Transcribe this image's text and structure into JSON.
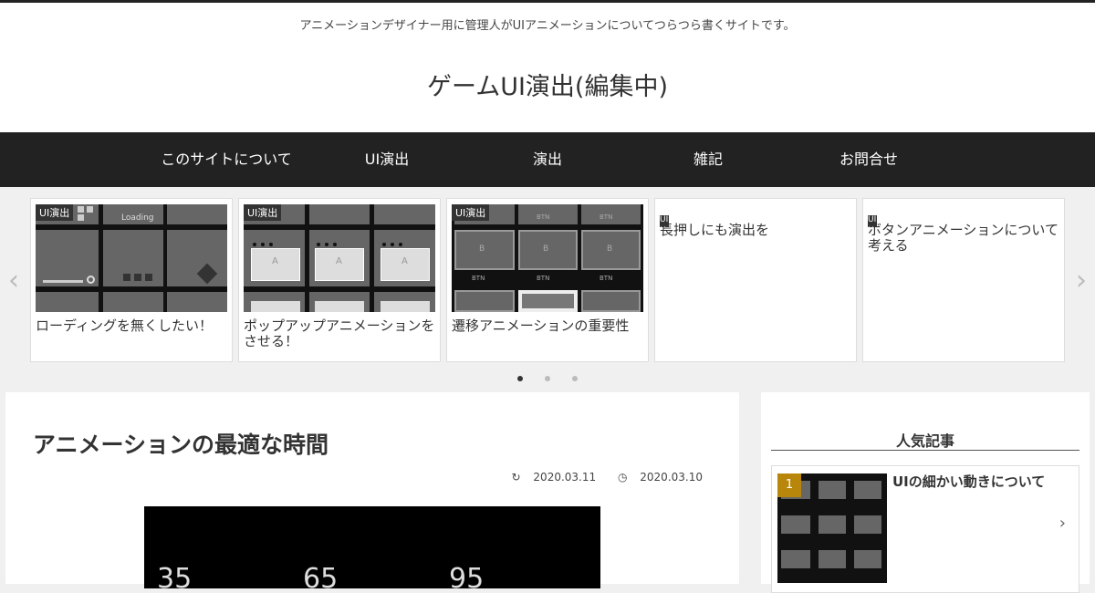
{
  "header": {
    "tagline": "アニメーションデザイナー用に管理人がUIアニメーションについてつらつら書くサイトです。",
    "site_title": "ゲームUI演出(編集中)"
  },
  "nav": {
    "items": [
      {
        "label": "このサイトについて"
      },
      {
        "label": "UI演出"
      },
      {
        "label": "演出"
      },
      {
        "label": "雑記"
      },
      {
        "label": "お問合せ"
      }
    ]
  },
  "carousel": {
    "prev_icon": "chevron-left-icon",
    "next_icon": "chevron-right-icon",
    "cards": [
      {
        "category": "UI演出",
        "title": "ローディングを無くしたい！",
        "thumb_text": "Loading"
      },
      {
        "category": "UI演出",
        "title": "ポップアップアニメーションをさせる！",
        "thumb_text": "A"
      },
      {
        "category": "UI演出",
        "title": "遷移アニメーションの重要性",
        "thumb_text": "BTN",
        "thumb_text2": "B"
      },
      {
        "category": "UI演出",
        "title": "長押しにも演出を"
      },
      {
        "category": "UI演出",
        "title": "ボタンアニメーションについて考える"
      }
    ],
    "dots": 3,
    "active_dot": 1
  },
  "post": {
    "title": "アニメーションの最適な時間",
    "updated": "2020.03.11",
    "published": "2020.03.10",
    "hero_numbers": [
      "35",
      "65",
      "95"
    ]
  },
  "sidebar": {
    "widget_title": "人気記事",
    "popular": [
      {
        "rank": "1",
        "title": "UIの細かい動きについて"
      }
    ]
  },
  "colors": {
    "nav_bg": "#222222",
    "rank_badge": "#b8860b"
  }
}
